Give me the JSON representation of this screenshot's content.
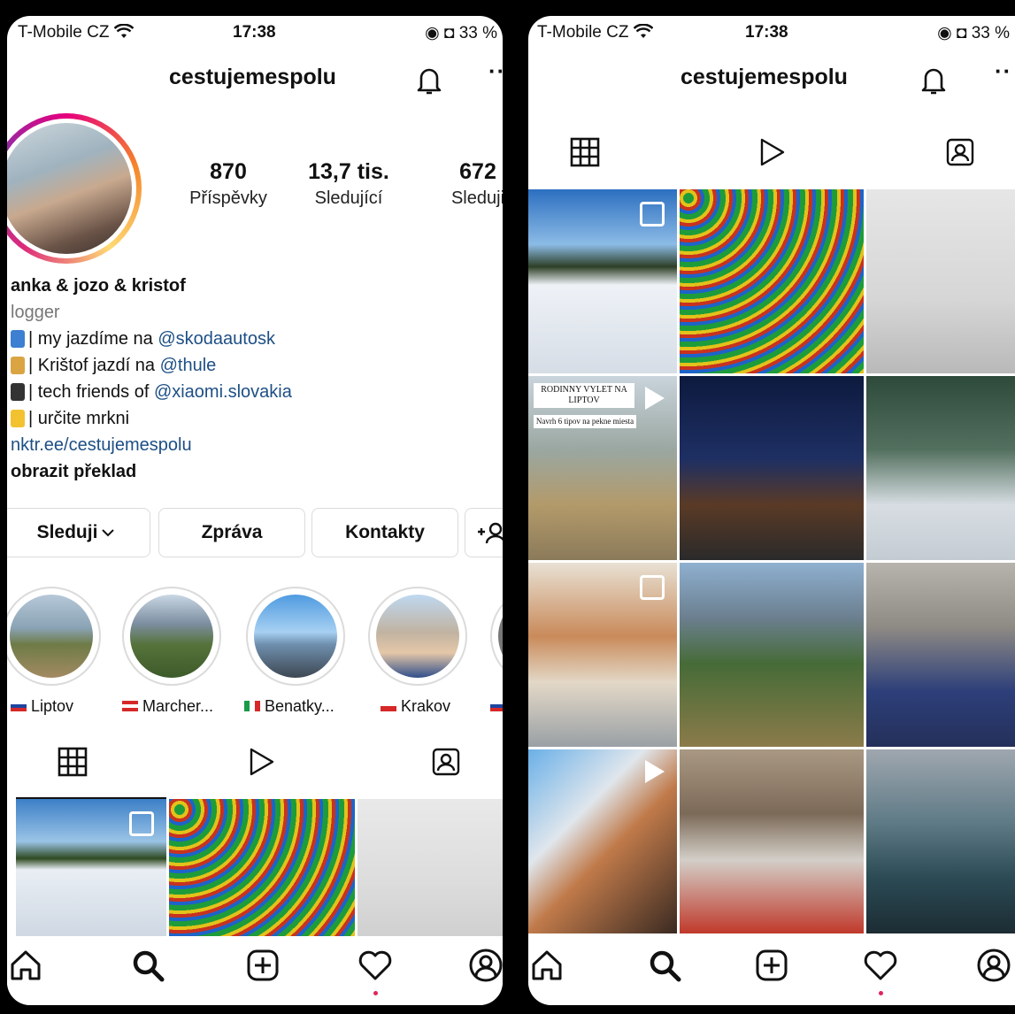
{
  "left": {
    "status": {
      "carrier": "T-Mobile CZ",
      "time": "17:38",
      "battery": "33 %"
    },
    "header": {
      "username": "cestujemespolu",
      "more": "··"
    },
    "stats": [
      {
        "value": "870",
        "label": "Příspěvky"
      },
      {
        "value": "13,7 tis.",
        "label": "Sledující"
      },
      {
        "value": "672",
        "label": "Sleduji"
      }
    ],
    "bio": {
      "name": "anka & jozo & kristof",
      "category": "logger",
      "line1_text": "| my jazdíme na ",
      "line1_mention": "@skodaautosk",
      "line2_text": "| Krištof jazdí na ",
      "line2_mention": "@thule",
      "line3_text": "| tech friends of ",
      "line3_mention": "@xiaomi.slovakia",
      "line4_text": "| určite mrkni",
      "link": "nktr.ee/cestujemespolu",
      "translate": "obrazit překlad"
    },
    "buttons": {
      "follow": "Sleduji",
      "message": "Zpráva",
      "contacts": "Kontakty",
      "add": "+ꕤ"
    },
    "highlights": [
      {
        "label": "Liptov"
      },
      {
        "label": "Marcher..."
      },
      {
        "label": "Benatky..."
      },
      {
        "label": "Krakov"
      }
    ]
  },
  "right": {
    "status": {
      "carrier": "T-Mobile CZ",
      "time": "17:38",
      "battery": "33 %"
    },
    "header": {
      "username": "cestujemespolu",
      "more": "··"
    },
    "overlay": {
      "title": "RODINNY VYLET NA LIPTOV",
      "subtitle": "Navrh 6 tipov na pekne miesta"
    }
  },
  "colors": {
    "accent_link": "#1d4f85",
    "notification_dot": "#e0245e",
    "border": "#dbdbdb"
  },
  "icons": [
    "wifi-icon",
    "bell-icon",
    "grid-icon",
    "reels-icon",
    "tagged-icon",
    "home-icon",
    "search-icon",
    "create-icon",
    "heart-icon",
    "profile-icon",
    "multi-photo-icon",
    "play-icon"
  ]
}
